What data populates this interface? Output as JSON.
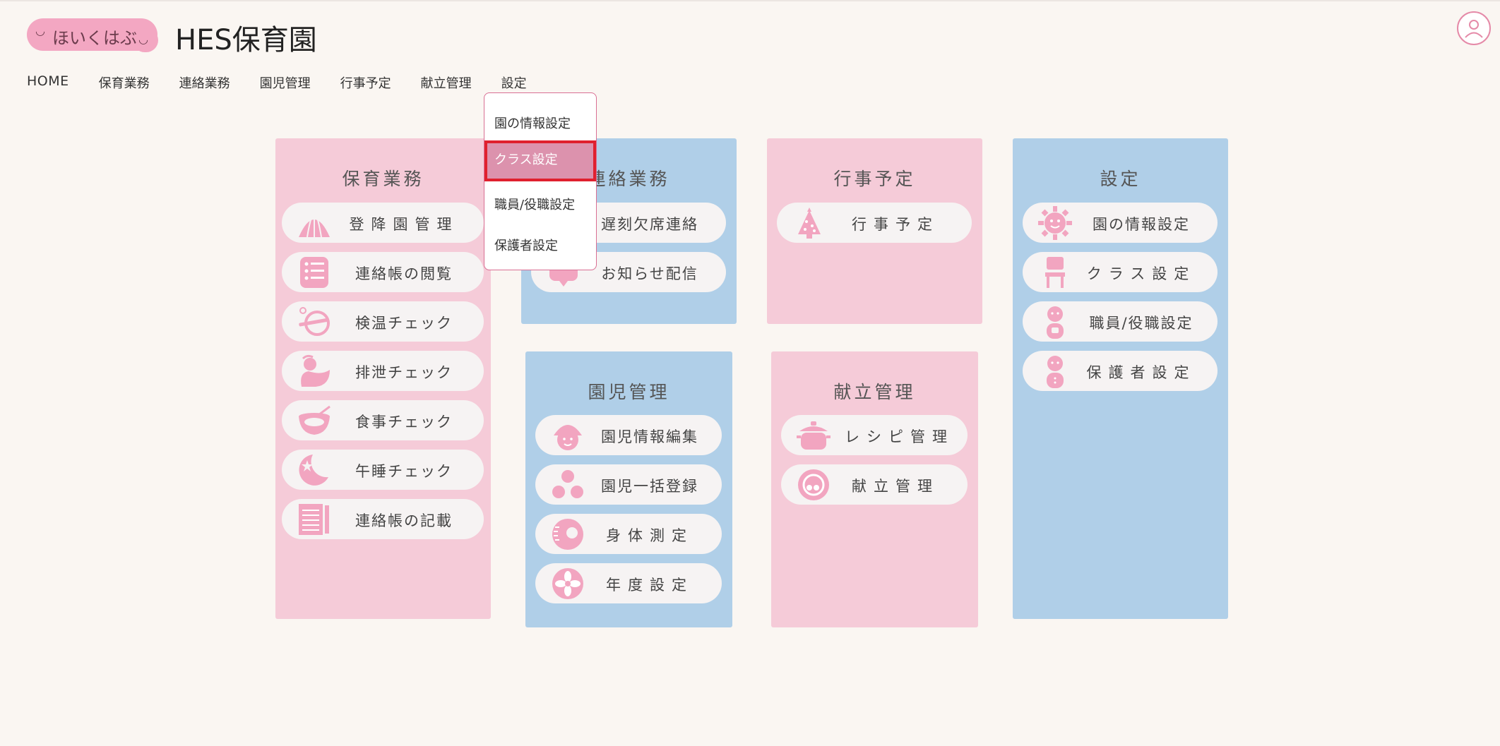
{
  "header": {
    "logo_text": "ほいくはぶ",
    "site_title": "HES保育園"
  },
  "nav": {
    "items": [
      "HOME",
      "保育業務",
      "連絡業務",
      "園児管理",
      "行事予定",
      "献立管理",
      "設定"
    ]
  },
  "dropdown": {
    "items": [
      "園の情報設定",
      "クラス設定",
      "職員/役職設定",
      "保護者設定"
    ],
    "active_index": 1
  },
  "panels": {
    "hoiku": {
      "title": "保育業務",
      "items": [
        "登降園管理",
        "連絡帳の閲覧",
        "検温チェック",
        "排泄チェック",
        "食事チェック",
        "午睡チェック",
        "連絡帳の記載"
      ]
    },
    "renraku": {
      "title": "連絡業務",
      "items": [
        "遅刻欠席連絡",
        "お知らせ配信"
      ]
    },
    "gyoji": {
      "title": "行事予定",
      "items": [
        "行事予定"
      ]
    },
    "settei": {
      "title": "設定",
      "items": [
        "園の情報設定",
        "クラス設定",
        "職員/役職設定",
        "保護者設定"
      ]
    },
    "enji": {
      "title": "園児管理",
      "items": [
        "園児情報編集",
        "園児一括登録",
        "身体測定",
        "年度設定"
      ]
    },
    "kondate": {
      "title": "献立管理",
      "items": [
        "レシピ管理",
        "献立管理"
      ]
    }
  },
  "colors": {
    "pink_panel": "#f5cbd8",
    "blue_panel": "#b0cfe8",
    "icon_pink": "#f2a5c0",
    "highlight_border": "#e0202e"
  }
}
